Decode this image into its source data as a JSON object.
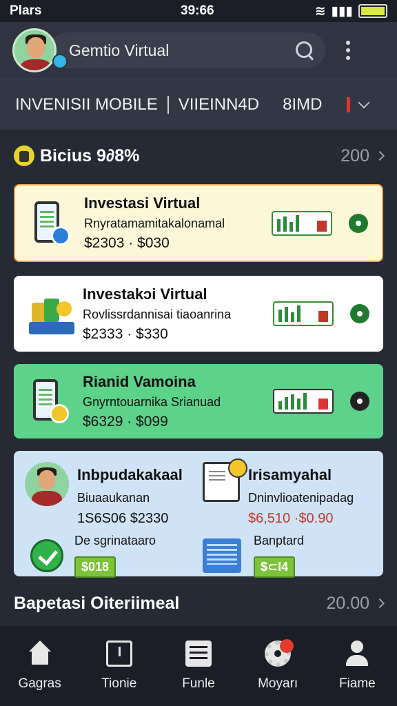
{
  "status_bar": {
    "carrier": "Plars",
    "time": "39:66"
  },
  "header": {
    "search_label": "Gemtio Virtual"
  },
  "subnav": {
    "item1": "INVENISII MOBILE",
    "item2": "VIIEINN4D",
    "item3": "8IMD"
  },
  "section1": {
    "title": "Bicius 9∂8%",
    "more": "200"
  },
  "cards": [
    {
      "title": "Investasi Virtual",
      "subtitle": "Rnyratamamitakalonamal",
      "price": "$2303 · $030",
      "bg": "#fbf7d8",
      "border": "#e8a54a"
    },
    {
      "title": "Investakɔi Virtual",
      "subtitle": "Rovlissrdannisai tiaoanrina",
      "price": "$2333 · $330",
      "bg": "#ffffff",
      "border": "#ffffff"
    },
    {
      "title": "Rianid Vamoina",
      "subtitle": "Gnyrntouarnika Srianuad",
      "price": "$6329 · $099",
      "bg": "#5cd28a",
      "border": "#5cd28a"
    }
  ],
  "combo": {
    "left": {
      "title": "Inbpudakakaal",
      "subtitle": "Biuaaukanan",
      "values": "1S6S06 $2330",
      "label": "De sgrinataaro",
      "pill": "$018"
    },
    "right": {
      "title": "Irisamyahal",
      "subtitle": "Dninvlioatenipadag",
      "values": "$6,510 ·$0.90",
      "label": "Banptard",
      "pill": "$⊂I4"
    }
  },
  "section2": {
    "title": "Bapetasi Oiteriimeal",
    "more": "20.00"
  },
  "bottom_nav": [
    {
      "label": "Gagras",
      "icon": "home-icon"
    },
    {
      "label": "Tionie",
      "icon": "clock-icon"
    },
    {
      "label": "Funle",
      "icon": "list-icon"
    },
    {
      "label": "Moyarı",
      "icon": "gear-icon"
    },
    {
      "label": "Fiame",
      "icon": "person-icon"
    }
  ],
  "colors": {
    "accent_green": "#2e8b3c",
    "notif_red": "#e23b2e",
    "card_yellow": "#fbf7d8",
    "card_green": "#5cd28a",
    "combo_blue": "#cfe3f7"
  }
}
